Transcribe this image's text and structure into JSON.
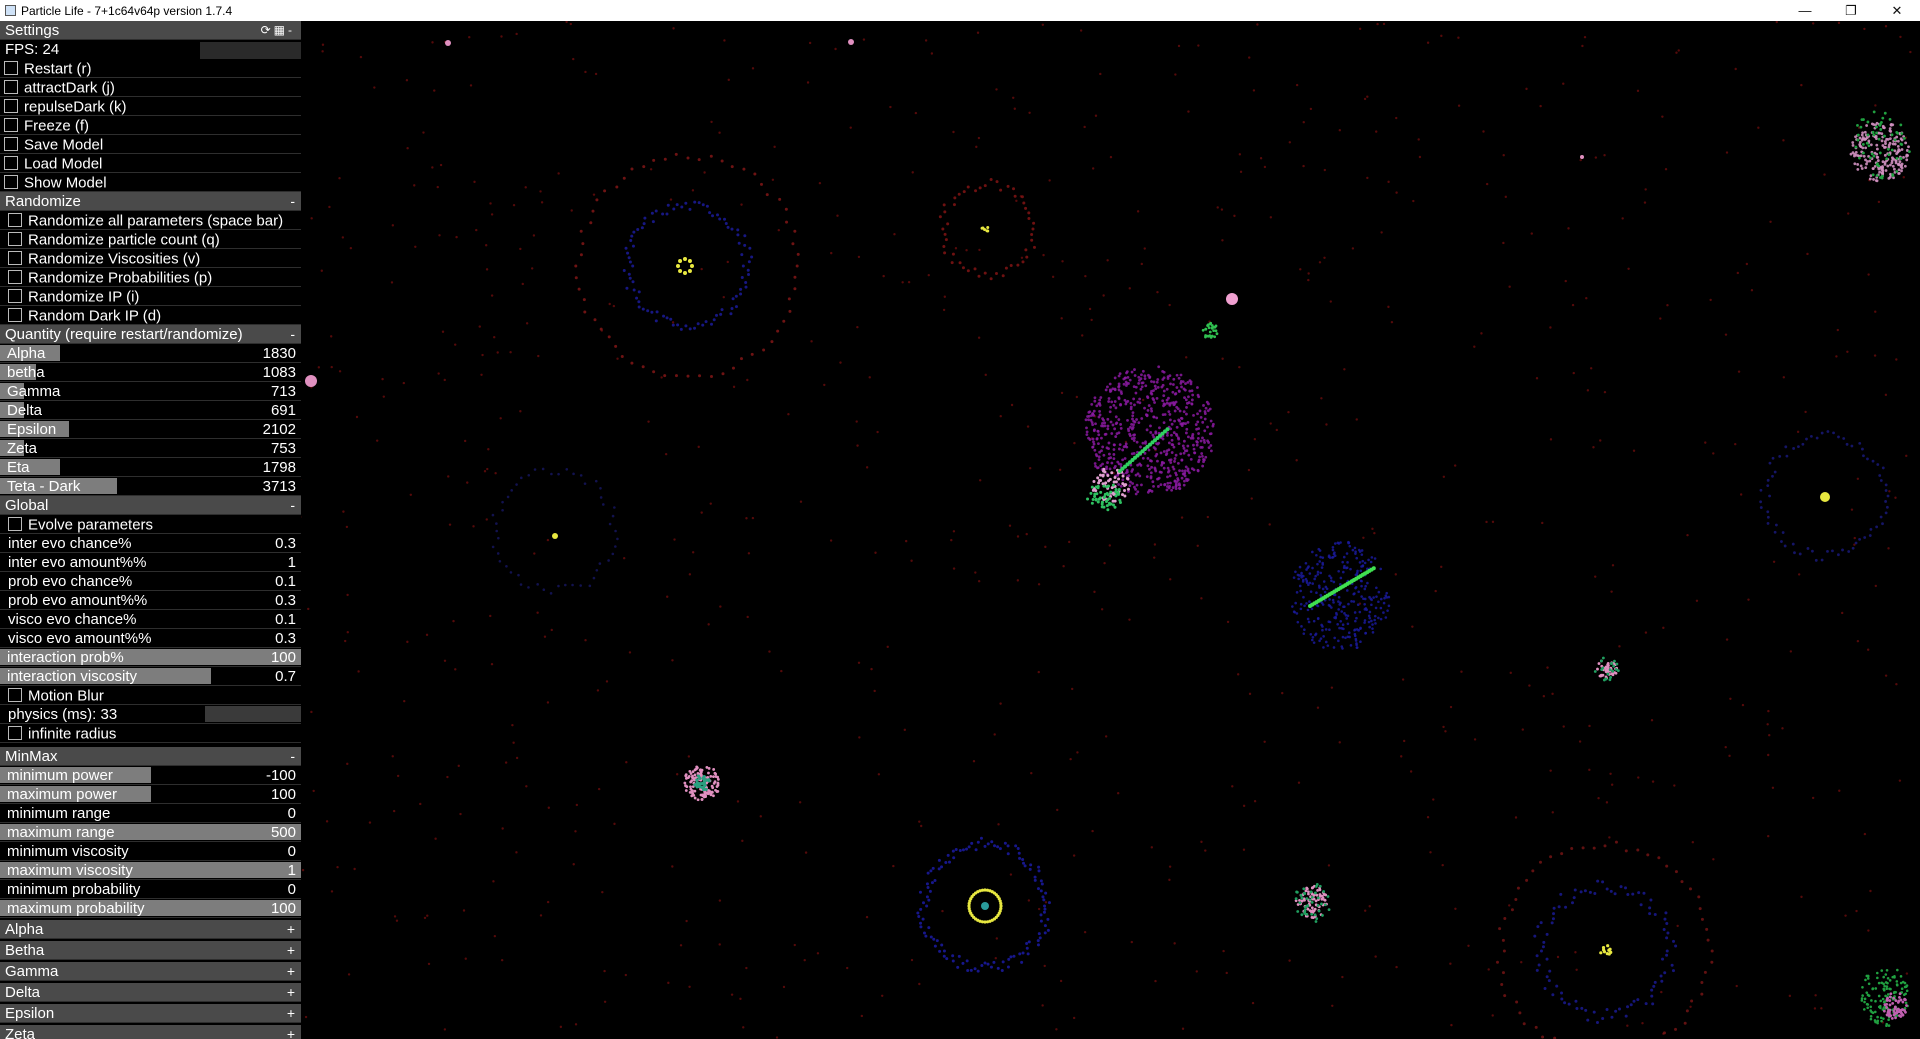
{
  "window": {
    "title": "Particle Life - 7+1c64v64p version 1.7.4",
    "minimize_icon": "minimize-icon",
    "maximize_icon": "restore-icon",
    "close_icon": "close-icon"
  },
  "settings": {
    "header": "Settings",
    "fps": "FPS: 24",
    "actions": [
      {
        "label": "Restart (r)"
      },
      {
        "label": "attractDark (j)"
      },
      {
        "label": "repulseDark (k)"
      },
      {
        "label": "Freeze (f)"
      },
      {
        "label": "Save Model"
      },
      {
        "label": "Load Model"
      },
      {
        "label": "Show Model"
      }
    ]
  },
  "randomize": {
    "header": "Randomize",
    "sign": "-",
    "items": [
      {
        "label": "Randomize all parameters (space bar)"
      },
      {
        "label": "Randomize particle count (q)"
      },
      {
        "label": "Randomize Viscosities (v)"
      },
      {
        "label": "Randomize Probabilities (p)"
      },
      {
        "label": "Randomize IP (i)"
      },
      {
        "label": "Random Dark IP (d)"
      }
    ]
  },
  "quantity": {
    "header": "Quantity (require restart/randomize)",
    "sign": "-",
    "items": [
      {
        "label": "Alpha",
        "value": "1830",
        "fill": 0.2
      },
      {
        "label": "betha",
        "value": "1083",
        "fill": 0.12
      },
      {
        "label": "Gamma",
        "value": "713",
        "fill": 0.08
      },
      {
        "label": "Delta",
        "value": "691",
        "fill": 0.08
      },
      {
        "label": "Epsilon",
        "value": "2102",
        "fill": 0.23
      },
      {
        "label": "Zeta",
        "value": "753",
        "fill": 0.08
      },
      {
        "label": "Eta",
        "value": "1798",
        "fill": 0.2
      },
      {
        "label": "Teta - Dark",
        "value": "3713",
        "fill": 0.39
      }
    ]
  },
  "global": {
    "header": "Global",
    "sign": "-",
    "evolve_label": "Evolve parameters",
    "params": [
      {
        "label": "inter evo chance%",
        "value": "0.3"
      },
      {
        "label": "inter evo amount%%",
        "value": "1"
      },
      {
        "label": "prob evo chance%",
        "value": "0.1"
      },
      {
        "label": "prob evo amount%%",
        "value": "0.3"
      },
      {
        "label": "visco evo chance%",
        "value": "0.1"
      },
      {
        "label": "visco evo amount%%",
        "value": "0.3"
      }
    ],
    "sliders": [
      {
        "label": "interaction prob%",
        "value": "100",
        "fill": 1.0
      },
      {
        "label": "interaction viscosity",
        "value": "0.7",
        "fill": 0.7
      }
    ],
    "motion_blur_label": "Motion Blur",
    "physics": "physics (ms): 33",
    "infinite_radius_label": "infinite radius"
  },
  "minmax": {
    "header": "MinMax",
    "sign": "-",
    "items": [
      {
        "label": "minimum power",
        "value": "-100",
        "fill": 0.5
      },
      {
        "label": "maximum power",
        "value": "100",
        "fill": 0.5
      },
      {
        "label": "minimum range",
        "value": "0",
        "fill": 0
      },
      {
        "label": "maximum range",
        "value": "500",
        "fill": 1.0
      },
      {
        "label": "minimum viscosity",
        "value": "0",
        "fill": 0
      },
      {
        "label": "maximum viscosity",
        "value": "1",
        "fill": 1.0
      },
      {
        "label": "minimum probability",
        "value": "0",
        "fill": 0
      },
      {
        "label": "maximum probability",
        "value": "100",
        "fill": 1.0
      }
    ]
  },
  "collapsed_groups": [
    {
      "label": "Alpha",
      "sign": "+"
    },
    {
      "label": "Betha",
      "sign": "+"
    },
    {
      "label": "Gamma",
      "sign": "+"
    },
    {
      "label": "Delta",
      "sign": "+"
    },
    {
      "label": "Epsilon",
      "sign": "+"
    },
    {
      "label": "Zeta",
      "sign": "+"
    }
  ]
}
